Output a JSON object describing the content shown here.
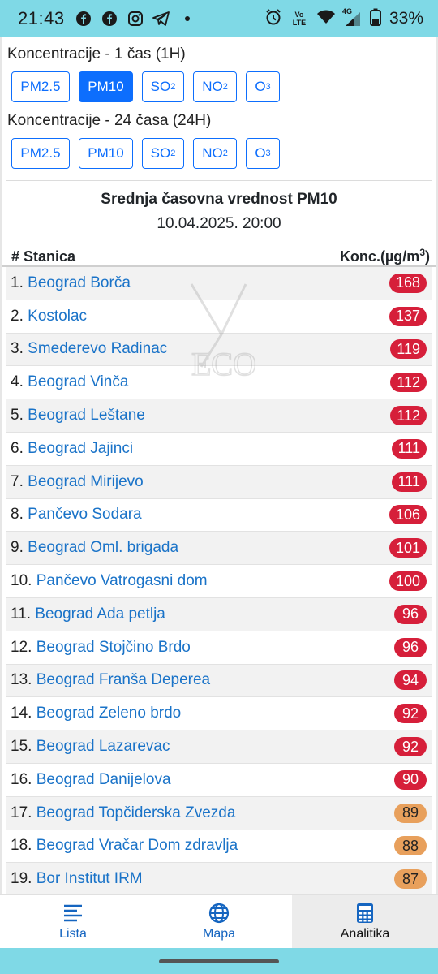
{
  "status_bar": {
    "time": "21:43",
    "battery": "33%",
    "network": "4G",
    "volte": "Vo LTE",
    "icons": [
      "facebook-icon",
      "facebook-icon",
      "instagram-icon",
      "telegram-icon",
      "alarm-icon",
      "volte-icon",
      "wifi-icon",
      "signal-icon",
      "battery-icon"
    ]
  },
  "hourly": {
    "title": "Koncentracije - 1 čas (1H)",
    "buttons": [
      {
        "base": "PM2.5",
        "sub": "",
        "active": false
      },
      {
        "base": "PM10",
        "sub": "",
        "active": true
      },
      {
        "base": "SO",
        "sub": "2",
        "active": false
      },
      {
        "base": "NO",
        "sub": "2",
        "active": false
      },
      {
        "base": "O",
        "sub": "3",
        "active": false
      }
    ]
  },
  "daily": {
    "title": "Koncentracije - 24 časa (24H)",
    "buttons": [
      {
        "base": "PM2.5",
        "sub": "",
        "active": false
      },
      {
        "base": "PM10",
        "sub": "",
        "active": false
      },
      {
        "base": "SO",
        "sub": "2",
        "active": false
      },
      {
        "base": "NO",
        "sub": "2",
        "active": false
      },
      {
        "base": "O",
        "sub": "3",
        "active": false
      }
    ]
  },
  "report": {
    "title": "Srednja časovna vrednost PM10",
    "datetime": "10.04.2025. 20:00"
  },
  "table": {
    "col_station": "# Stanica",
    "col_conc_prefix": "Konc.(µg/m",
    "col_conc_sup": "3",
    "col_conc_suffix": ")",
    "rows": [
      {
        "rank": "1.",
        "station": "Beograd Borča",
        "value": "168",
        "level": "red"
      },
      {
        "rank": "2.",
        "station": "Kostolac",
        "value": "137",
        "level": "red"
      },
      {
        "rank": "3.",
        "station": "Smederevo Radinac",
        "value": "119",
        "level": "red"
      },
      {
        "rank": "4.",
        "station": "Beograd Vinča",
        "value": "112",
        "level": "red"
      },
      {
        "rank": "5.",
        "station": "Beograd Leštane",
        "value": "112",
        "level": "red"
      },
      {
        "rank": "6.",
        "station": "Beograd Jajinci",
        "value": "111",
        "level": "red"
      },
      {
        "rank": "7.",
        "station": "Beograd Mirijevo",
        "value": "111",
        "level": "red"
      },
      {
        "rank": "8.",
        "station": "Pančevo Sodara",
        "value": "106",
        "level": "red"
      },
      {
        "rank": "9.",
        "station": "Beograd Oml. brigada",
        "value": "101",
        "level": "red"
      },
      {
        "rank": "10.",
        "station": "Pančevo Vatrogasni dom",
        "value": "100",
        "level": "red"
      },
      {
        "rank": "11.",
        "station": "Beograd Ada petlja",
        "value": "96",
        "level": "red"
      },
      {
        "rank": "12.",
        "station": "Beograd Stojčino Brdo",
        "value": "96",
        "level": "red"
      },
      {
        "rank": "13.",
        "station": "Beograd Franša Deperea",
        "value": "94",
        "level": "red"
      },
      {
        "rank": "14.",
        "station": "Beograd Zeleno brdo",
        "value": "92",
        "level": "red"
      },
      {
        "rank": "15.",
        "station": "Beograd Lazarevac",
        "value": "92",
        "level": "red"
      },
      {
        "rank": "16.",
        "station": "Beograd Danijelova",
        "value": "90",
        "level": "red"
      },
      {
        "rank": "17.",
        "station": "Beograd Topčiderska Zvezda",
        "value": "89",
        "level": "orange"
      },
      {
        "rank": "18.",
        "station": "Beograd Vračar Dom zdravlja",
        "value": "88",
        "level": "orange"
      },
      {
        "rank": "19.",
        "station": "Bor Institut IRM",
        "value": "87",
        "level": "orange"
      }
    ]
  },
  "colors": {
    "primary": "#0d6efd",
    "link": "#1a73c8",
    "badge_red": "#d61f3a",
    "badge_orange": "#e8a05c",
    "status_bar": "#7fd9e6"
  },
  "nav": [
    {
      "label": "Lista",
      "icon": "list-icon",
      "active": false
    },
    {
      "label": "Mapa",
      "icon": "globe-icon",
      "active": false
    },
    {
      "label": "Analitika",
      "icon": "calculator-icon",
      "active": true
    }
  ]
}
